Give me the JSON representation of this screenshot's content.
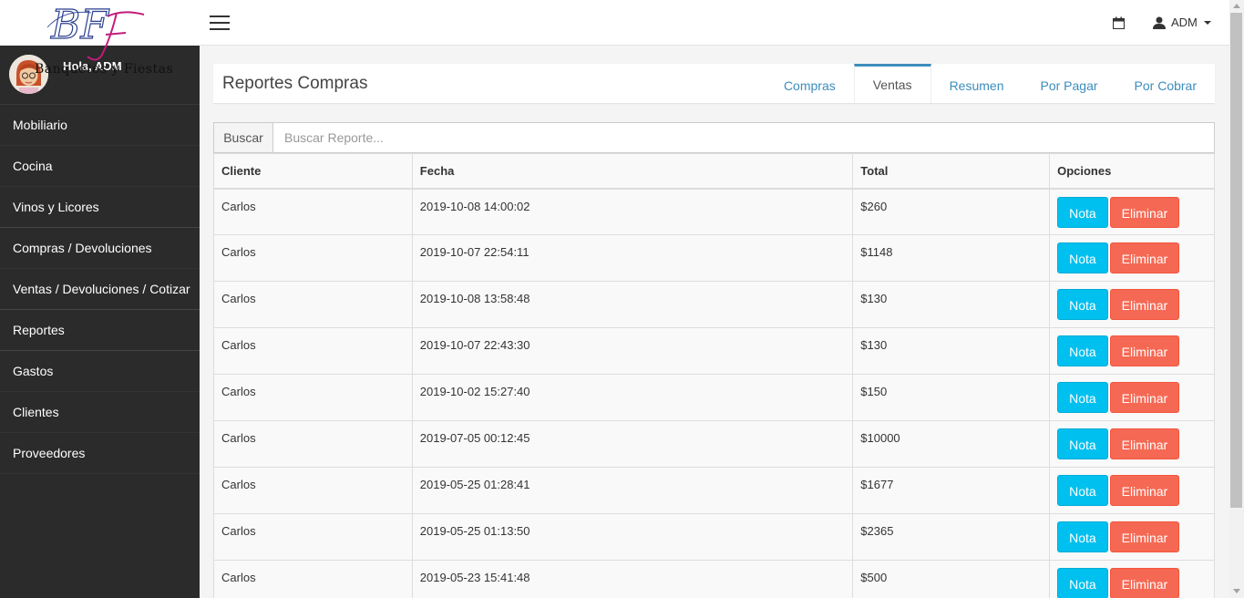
{
  "sidebar": {
    "brand": "Banquetes y Fiestas",
    "brand_initials": "BF",
    "greeting": "Hola, ADM",
    "items": [
      {
        "label": "Mobiliario"
      },
      {
        "label": "Cocina"
      },
      {
        "label": "Vinos y Licores"
      },
      {
        "label": "Compras / Devoluciones"
      },
      {
        "label": "Ventas / Devoluciones / Cotizar"
      },
      {
        "label": "Reportes"
      },
      {
        "label": "Gastos"
      },
      {
        "label": "Clientes"
      },
      {
        "label": "Proveedores"
      }
    ]
  },
  "topbar": {
    "user": "ADM",
    "icons": [
      "hamburger-menu-icon",
      "calendar-icon",
      "user-icon"
    ]
  },
  "header": {
    "title": "Reportes Compras",
    "tabs": [
      {
        "label": "Compras",
        "active": false
      },
      {
        "label": "Ventas",
        "active": true
      },
      {
        "label": "Resumen",
        "active": false
      },
      {
        "label": "Por Pagar",
        "active": false
      },
      {
        "label": "Por Cobrar",
        "active": false
      }
    ]
  },
  "search": {
    "label": "Buscar",
    "placeholder": "Buscar Reporte..."
  },
  "table": {
    "columns": [
      "Cliente",
      "Fecha",
      "Total",
      "Opciones"
    ],
    "rows": [
      {
        "cliente": "Carlos",
        "fecha": "2019-10-08 14:00:02",
        "total": "$260"
      },
      {
        "cliente": "Carlos",
        "fecha": "2019-10-07 22:54:11",
        "total": "$1148"
      },
      {
        "cliente": "Carlos",
        "fecha": "2019-10-08 13:58:48",
        "total": "$130"
      },
      {
        "cliente": "Carlos",
        "fecha": "2019-10-07 22:43:30",
        "total": "$130"
      },
      {
        "cliente": "Carlos",
        "fecha": "2019-10-02 15:27:40",
        "total": "$150"
      },
      {
        "cliente": "Carlos",
        "fecha": "2019-07-05 00:12:45",
        "total": "$10000"
      },
      {
        "cliente": "Carlos",
        "fecha": "2019-05-25 01:28:41",
        "total": "$1677"
      },
      {
        "cliente": "Carlos",
        "fecha": "2019-05-25 01:13:50",
        "total": "$2365"
      },
      {
        "cliente": "Carlos",
        "fecha": "2019-05-23 15:41:48",
        "total": "$500"
      }
    ],
    "buttons": {
      "nota": "Nota",
      "eliminar": "Eliminar"
    }
  },
  "colors": {
    "sidebar_bg": "#2b2b2b",
    "accent": "#3c8dbc",
    "btn_info": "#00c0ef",
    "btn_danger": "#f56954"
  }
}
